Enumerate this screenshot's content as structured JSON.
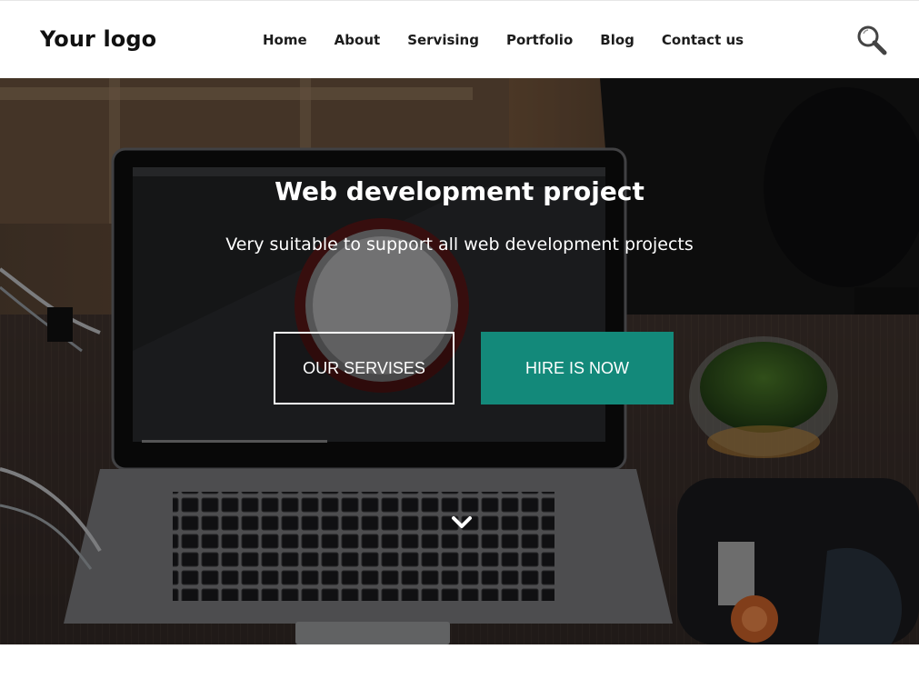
{
  "header": {
    "logo": "Your logo",
    "nav": [
      "Home",
      "About",
      "Servising",
      "Portfolio",
      "Blog",
      "Contact us"
    ],
    "search_icon": "search-icon"
  },
  "hero": {
    "title": "Web development project",
    "subtitle": "Very suitable to support all web development projects",
    "buttons": {
      "secondary_label": "OUR SERVISES",
      "primary_label": "HIRE IS NOW"
    },
    "scroll_icon": "chevron-down-icon"
  },
  "colors": {
    "accent": "#13897a",
    "header_bg": "#ffffff",
    "text_dark": "#1c1c1c"
  }
}
